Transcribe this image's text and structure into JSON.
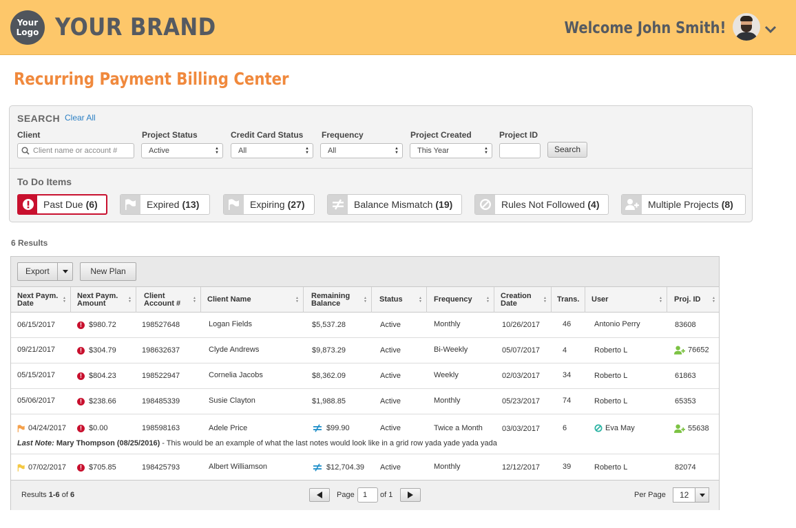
{
  "header": {
    "logo_line1": "Your",
    "logo_line2": "Logo",
    "brand": "YOUR BRAND",
    "welcome": "Welcome John Smith!"
  },
  "page_title": "Recurring Payment Billing Center",
  "search": {
    "title": "SEARCH",
    "clear_all": "Clear All",
    "client_label": "Client",
    "client_placeholder": "Client name or account #",
    "project_status_label": "Project Status",
    "project_status_value": "Active",
    "cc_status_label": "Credit Card Status",
    "cc_status_value": "All",
    "frequency_label": "Frequency",
    "frequency_value": "All",
    "project_created_label": "Project Created",
    "project_created_value": "This Year",
    "project_id_label": "Project ID",
    "project_id_value": "",
    "search_button": "Search"
  },
  "todo": {
    "title": "To Do Items",
    "items": [
      {
        "label": "Past Due",
        "count": "(6)",
        "icon": "exclamation-icon"
      },
      {
        "label": "Expired",
        "count": "(13)",
        "icon": "flag-icon"
      },
      {
        "label": "Expiring",
        "count": "(27)",
        "icon": "flag-icon"
      },
      {
        "label": "Balance Mismatch",
        "count": "(19)",
        "icon": "not-equal-icon"
      },
      {
        "label": "Rules Not Followed",
        "count": "(4)",
        "icon": "prohibited-icon"
      },
      {
        "label": "Multiple Projects",
        "count": "(8)",
        "icon": "add-user-icon"
      }
    ]
  },
  "results_count": "6 Results",
  "grid": {
    "export_label": "Export",
    "new_plan_label": "New Plan",
    "columns": [
      {
        "l1": "Next Paym.",
        "l2": "Date"
      },
      {
        "l1": "Next Paym.",
        "l2": "Amount"
      },
      {
        "l1": "Client",
        "l2": "Account #"
      },
      {
        "l1": "Client Name",
        "l2": ""
      },
      {
        "l1": "Remaining",
        "l2": "Balance"
      },
      {
        "l1": "Status",
        "l2": ""
      },
      {
        "l1": "Frequency",
        "l2": ""
      },
      {
        "l1": "Creation",
        "l2": "Date"
      },
      {
        "l1": "Trans.",
        "l2": ""
      },
      {
        "l1": "User",
        "l2": ""
      },
      {
        "l1": "Proj. ID",
        "l2": ""
      }
    ],
    "rows": [
      {
        "date": "06/15/2017",
        "amount": "$980.72",
        "account": "198527648",
        "name": "Logan Fields",
        "balance": "$5,537.28",
        "status": "Active",
        "frequency": "Monthly",
        "created": "10/26/2017",
        "trans": "46",
        "user": "Antonio Perry",
        "proj": "83608"
      },
      {
        "date": "09/21/2017",
        "amount": "$304.79",
        "account": "198632637",
        "name": "Clyde Andrews",
        "balance": "$9,873.29",
        "status": "Active",
        "frequency": "Bi-Weekly",
        "created": "05/07/2017",
        "trans": "4",
        "user": "Roberto L",
        "proj": "76652"
      },
      {
        "date": "05/15/2017",
        "amount": "$804.23",
        "account": "198522947",
        "name": "Cornelia Jacobs",
        "balance": "$8,362.09",
        "status": "Active",
        "frequency": "Weekly",
        "created": "02/03/2017",
        "trans": "34",
        "user": "Roberto L",
        "proj": "61863"
      },
      {
        "date": "05/06/2017",
        "amount": "$238.66",
        "account": "198485339",
        "name": "Susie Clayton",
        "balance": "$1,988.85",
        "status": "Active",
        "frequency": "Monthly",
        "created": "05/23/2017",
        "trans": "74",
        "user": "Roberto L",
        "proj": "65353"
      },
      {
        "date": "04/24/2017",
        "amount": "$0.00",
        "account": "198598163",
        "name": "Adele Price",
        "balance": "$99.90",
        "status": "Active",
        "frequency": "Twice a Month",
        "created": "03/03/2017",
        "trans": "6",
        "user": "Eva May",
        "proj": "55638"
      },
      {
        "date": "07/02/2017",
        "amount": "$705.85",
        "account": "198425793",
        "name": "Albert Williamson",
        "balance": "$12,704.39",
        "status": "Active",
        "frequency": "Monthly",
        "created": "12/12/2017",
        "trans": "39",
        "user": "Roberto L",
        "proj": "82074"
      }
    ],
    "note": {
      "prefix": "Last Note:",
      "author": "Mary Thompson (08/25/2016)",
      "text": " - This would be an example of what the last notes would look like in a grid row yada yade yada yada"
    },
    "footer": {
      "results_prefix": "Results ",
      "results_range": "1-6",
      "results_of": " of ",
      "results_total": "6",
      "page_label": "Page",
      "page_value": "1",
      "page_of": "of 1",
      "per_page_label": "Per Page",
      "per_page_value": "12"
    }
  },
  "colors": {
    "header_bg": "#fdc76a",
    "title_orange": "#f0893d",
    "alert_red": "#c8102e",
    "flag_orange": "#f5a04a",
    "flag_yellow": "#f4c842",
    "mismatch_blue": "#1f8fc9",
    "rules_teal": "#2bb3a3",
    "multi_green": "#7cc243",
    "link_blue": "#2a7fc4"
  }
}
